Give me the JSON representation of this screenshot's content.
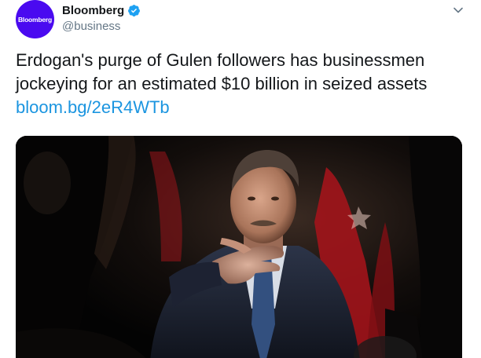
{
  "account": {
    "avatar_text": "Bloomberg",
    "display_name": "Bloomberg",
    "handle": "@business",
    "verified": true
  },
  "tweet": {
    "text": "Erdogan's purge of Gulen followers has businessmen jockeying for an estimated $10 billion in seized assets",
    "link": "bloom.bg/2eR4WTb"
  },
  "icons": {
    "verified": "verified-badge-icon",
    "caret": "chevron-down-icon"
  },
  "colors": {
    "avatar_bg": "#4a0af0",
    "link": "#1b95e0",
    "verified": "#1da1f2",
    "text": "#14171a",
    "secondary_text": "#657786"
  }
}
